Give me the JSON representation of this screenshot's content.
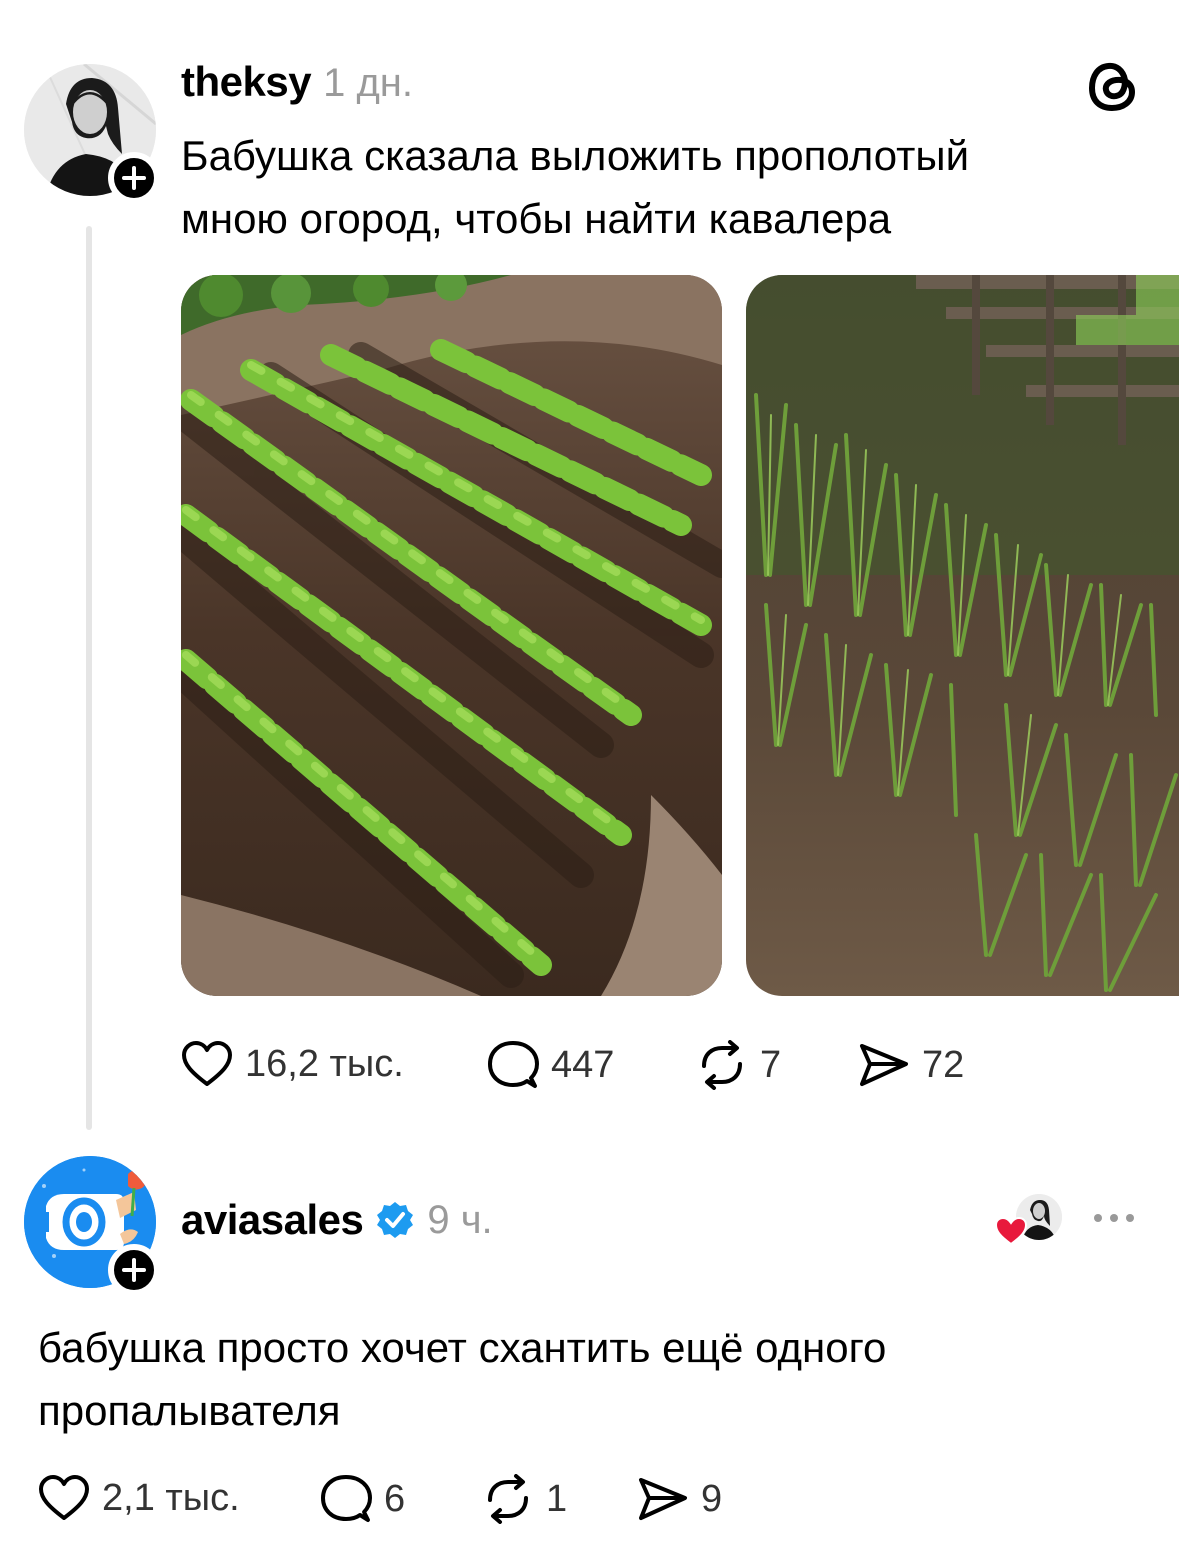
{
  "post": {
    "username": "theksy",
    "time": "1 дн.",
    "text_line1": "Бабушка сказала выложить прополотый",
    "text_line2": "мною огород, чтобы найти кавалера",
    "photos": [
      "photo-carrots",
      "photo-onions"
    ],
    "likes": "16,2 тыс.",
    "comments": "447",
    "reposts": "7",
    "shares": "72"
  },
  "reply": {
    "username": "aviasales",
    "verified": true,
    "time": "9 ч.",
    "text_line1": "бабушка просто хочет схантить ещё одного",
    "text_line2": "пропалывателя",
    "likes": "2,1 тыс.",
    "comments": "6",
    "reposts": "1",
    "shares": "9"
  },
  "colors": {
    "text": "#000000",
    "muted": "#9a9a9a",
    "verified": "#1d9bf0",
    "like_heart": "#e8193c",
    "thread_line": "#e5e5e5",
    "aviasales_blue": "#1a8cf0"
  },
  "icons": [
    "threads-logo-icon",
    "heart-icon",
    "comment-icon",
    "repost-icon",
    "share-icon",
    "verified-icon",
    "more-icon",
    "plus-icon"
  ]
}
